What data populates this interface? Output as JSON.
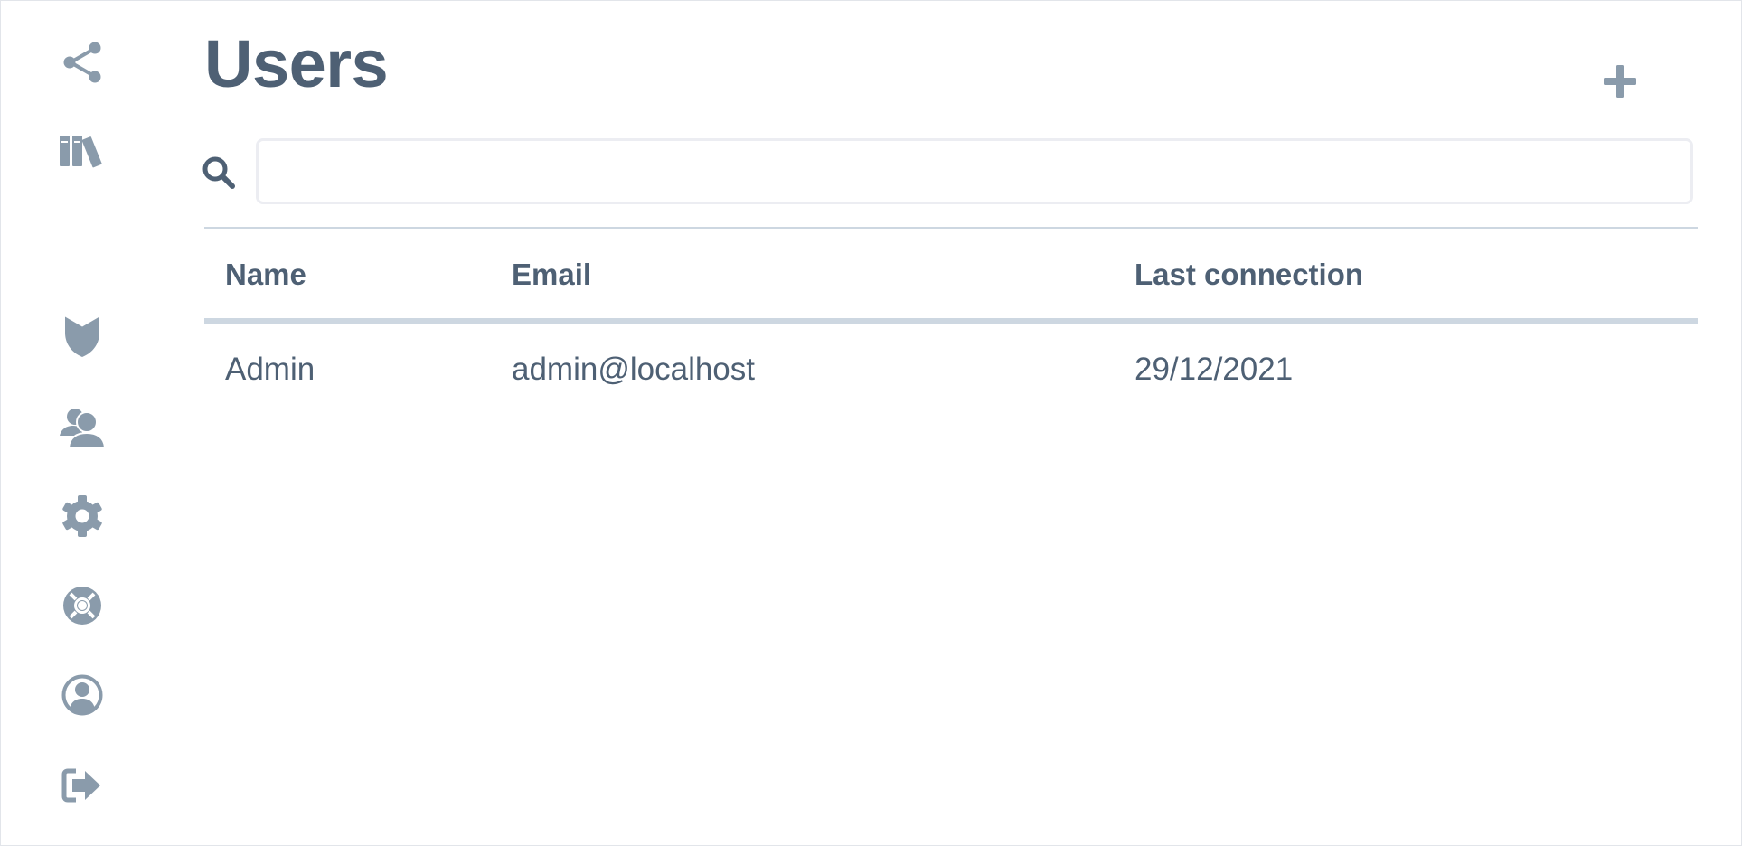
{
  "page": {
    "title": "Users"
  },
  "sidebar": {
    "items": [
      {
        "icon": "share-icon"
      },
      {
        "icon": "library-icon"
      },
      {
        "icon": "shield-icon"
      },
      {
        "icon": "users-icon"
      },
      {
        "icon": "gear-icon"
      },
      {
        "icon": "lifebuoy-icon"
      },
      {
        "icon": "user-circle-icon"
      },
      {
        "icon": "logout-icon"
      }
    ]
  },
  "toolbar": {
    "add_icon": "plus-icon"
  },
  "search": {
    "icon": "search-icon",
    "value": "",
    "placeholder": ""
  },
  "table": {
    "columns": [
      "Name",
      "Email",
      "Last connection"
    ],
    "rows": [
      {
        "name": "Admin",
        "email": "admin@localhost",
        "last_connection": "29/12/2021"
      }
    ]
  },
  "colors": {
    "icon": "#8a9bab",
    "text": "#4e6074",
    "divider": "#cdd7e1",
    "input_border": "#ecedf2"
  }
}
